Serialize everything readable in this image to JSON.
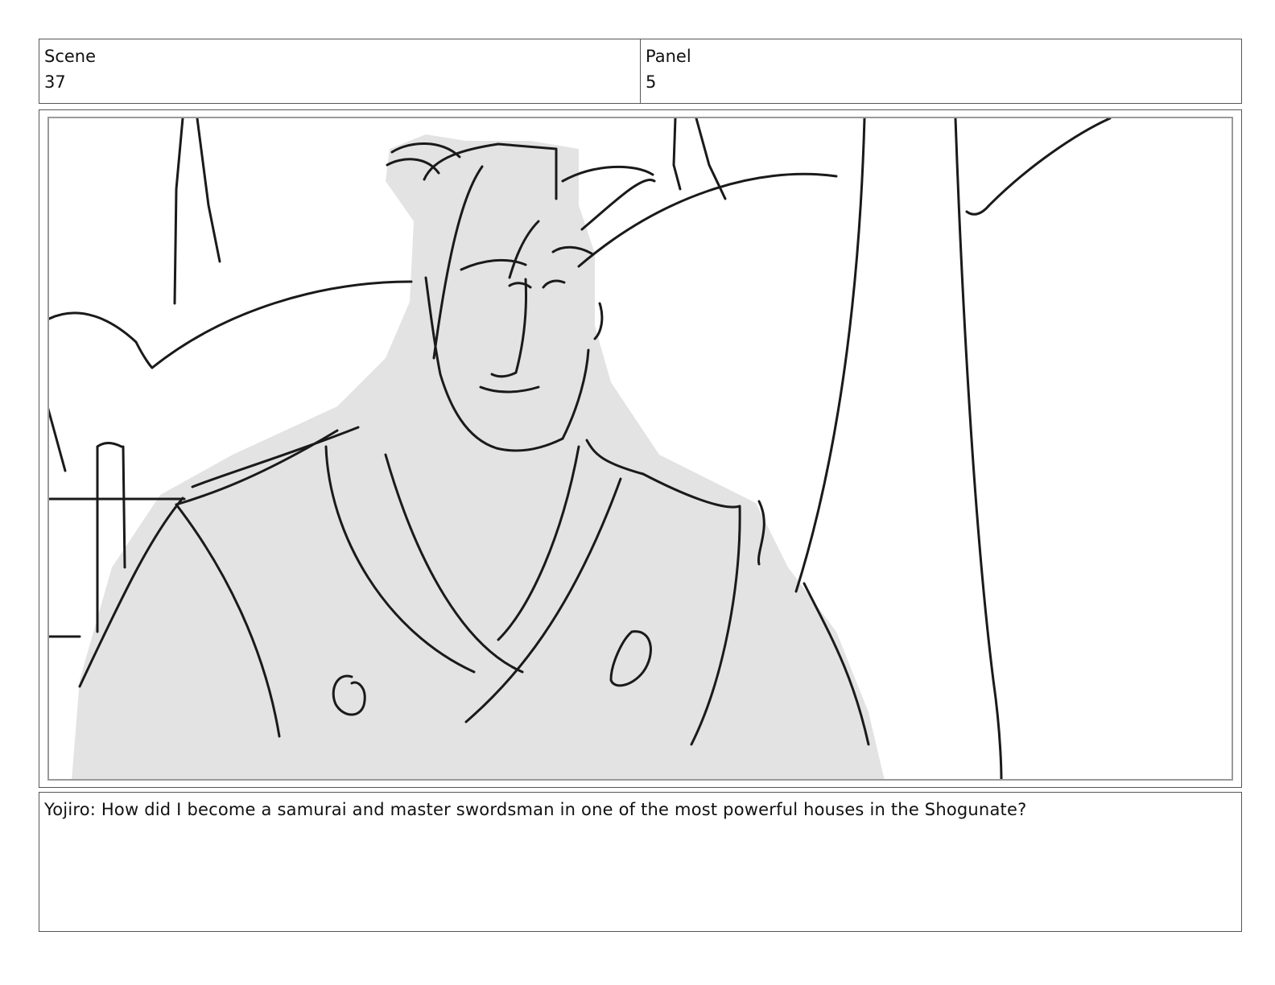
{
  "header": {
    "scene_label": "Scene",
    "scene_value": "37",
    "panel_label": "Panel",
    "panel_value": "5"
  },
  "caption": {
    "text": "Yojiro: How did I become a samurai and master swordsman in one of the most powerful houses in the Shogunate?"
  },
  "sketch": {
    "subject": "storyboard-sketch-samurai",
    "fill_color": "#e3e3e3",
    "line_color": "#1a1a1a"
  }
}
